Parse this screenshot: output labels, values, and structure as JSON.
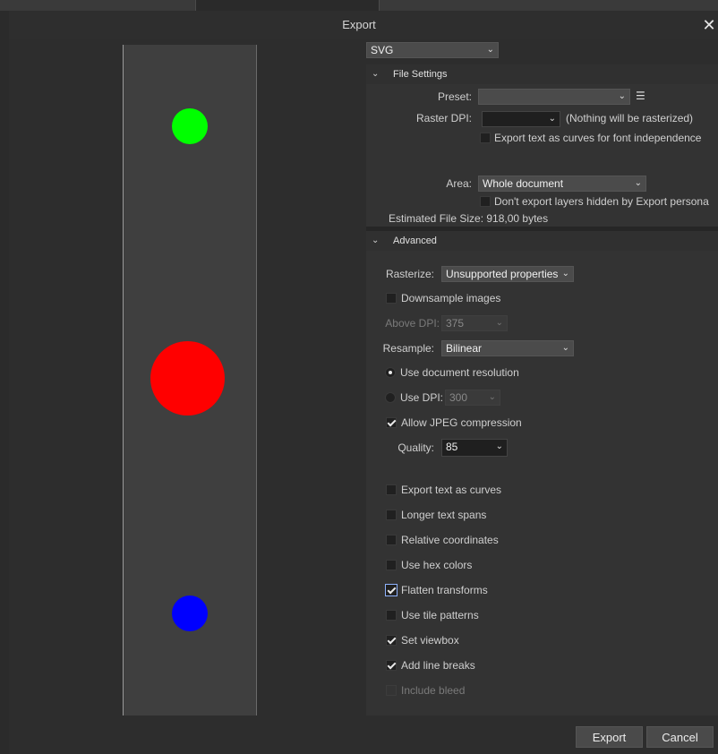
{
  "dialog": {
    "title": "Export",
    "close_glyph": "✕"
  },
  "format": {
    "value": "SVG"
  },
  "file_settings": {
    "section_label": "File Settings",
    "preset_label": "Preset:",
    "preset_value": "",
    "raster_dpi_label": "Raster DPI:",
    "raster_dpi_value": "",
    "raster_note": "(Nothing will be rasterized)",
    "export_text_curves_label": "Export text as curves for font independence",
    "area_label": "Area:",
    "area_value": "Whole document",
    "dont_export_hidden_label": "Don't export layers hidden by Export persona",
    "estimated_size": "Estimated File Size: 918,00 bytes"
  },
  "advanced": {
    "section_label": "Advanced",
    "rasterize_label": "Rasterize:",
    "rasterize_value": "Unsupported properties",
    "downsample_label": "Downsample images",
    "above_dpi_label": "Above DPI:",
    "above_dpi_value": "375",
    "resample_label": "Resample:",
    "resample_value": "Bilinear",
    "use_doc_res_label": "Use document resolution",
    "use_dpi_label": "Use DPI:",
    "use_dpi_value": "300",
    "allow_jpeg_label": "Allow JPEG compression",
    "quality_label": "Quality:",
    "quality_value": "85",
    "options": [
      {
        "label": "Export text as curves",
        "checked": false
      },
      {
        "label": "Longer text spans",
        "checked": false
      },
      {
        "label": "Relative coordinates",
        "checked": false
      },
      {
        "label": "Use hex colors",
        "checked": false
      },
      {
        "label": "Flatten transforms",
        "checked": true
      },
      {
        "label": "Use tile patterns",
        "checked": false
      },
      {
        "label": "Set viewbox",
        "checked": true
      },
      {
        "label": "Add line breaks",
        "checked": true
      },
      {
        "label": "Include bleed",
        "checked": false
      }
    ]
  },
  "preview": {
    "dots": [
      {
        "color": "#00ff00"
      },
      {
        "color": "#ff0000"
      },
      {
        "color": "#0000ff"
      }
    ]
  },
  "buttons": {
    "export": "Export",
    "cancel": "Cancel"
  },
  "icons": {
    "chevron": "chevron-down-icon",
    "menu": "hamburger-menu-icon",
    "close": "close-icon"
  }
}
